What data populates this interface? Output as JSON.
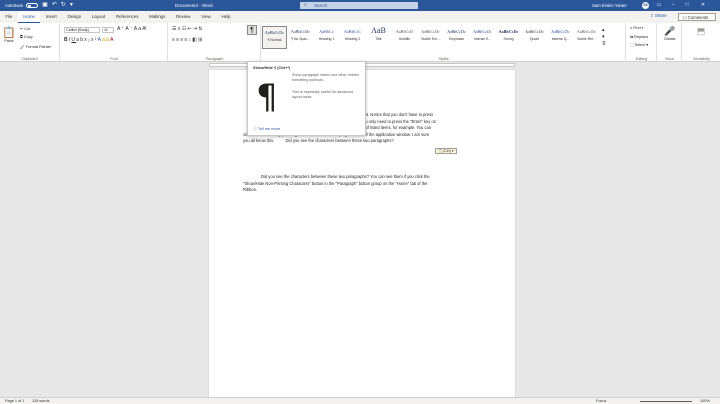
{
  "titlebar": {
    "autosave_label": "AutoSave",
    "autosave_state": "Off",
    "doc_title": "Document4 - Word",
    "search_placeholder": "Search",
    "user_name": "Sam Ervinn Yanter",
    "user_initials": "SE"
  },
  "tabs": [
    "File",
    "Home",
    "Insert",
    "Design",
    "Layout",
    "References",
    "Mailings",
    "Review",
    "View",
    "Help"
  ],
  "share_label": "Share",
  "comments_label": "Comments",
  "ribbon": {
    "clipboard": {
      "paste": "Paste",
      "cut": "Cut",
      "copy": "Copy",
      "format_painter": "Format Painter",
      "label": "Clipboard"
    },
    "font": {
      "font_name": "Calibri (Body)",
      "font_size": "11",
      "label": "Font"
    },
    "paragraph": {
      "label": "Paragraph"
    },
    "styles": {
      "label": "Styles",
      "items": [
        {
          "sample": "AaBbCcDc",
          "name": "¶ Normal"
        },
        {
          "sample": "AaBbCcDc",
          "name": "¶ No Spac..."
        },
        {
          "sample": "AaBbCc",
          "name": "Heading 1"
        },
        {
          "sample": "AaBbCcC",
          "name": "Heading 2"
        },
        {
          "sample": "AaB",
          "name": "Title"
        },
        {
          "sample": "AaBbCcD",
          "name": "Subtitle"
        },
        {
          "sample": "AaBbCcDc",
          "name": "Subtle Em..."
        },
        {
          "sample": "AaBbCcDc",
          "name": "Emphasis"
        },
        {
          "sample": "AaBbCcDc",
          "name": "Intense E..."
        },
        {
          "sample": "AaBbCcDc",
          "name": "Strong"
        },
        {
          "sample": "AaBbCcDc",
          "name": "Quote"
        },
        {
          "sample": "AaBbCcDc",
          "name": "Intense Q..."
        },
        {
          "sample": "AaBbCcDc",
          "name": "Subtle Ref..."
        }
      ]
    },
    "editing": {
      "find": "Find",
      "replace": "Replace",
      "select": "Select",
      "label": "Editing"
    },
    "voice": {
      "dictate": "Dictate",
      "label": "Voice"
    },
    "sensitivity": {
      "label": "Sensitivity"
    }
  },
  "tooltip": {
    "title": "Show/Hide ¶ (Ctrl+*)",
    "icon": "¶",
    "desc1": "Show paragraph marks and other hidden formatting symbols.",
    "desc2": "This is especially useful for advanced layout tasks.",
    "tell_me_more": "Tell me more"
  },
  "document": {
    "para1": {
      "line1": "document. Notice that you don't have to press",
      "line2": "lines. You only need to press the \"Enter\" key on",
      "line3": "of a line of listed items, for example. You can",
      "line4": "close a document by pressing the \"X\" button in the top right corner of the application window. I am sure",
      "line5": "you all know this.          Did you see the characters between these two paragraphs?"
    },
    "paste_tag": "(Ctrl) ▾",
    "para2": {
      "line1": "Did you see the characters between these two paragraphs? You can see them if you click the",
      "line2": "\"Show/Hide Non-Printing Characters\" button in the \"Paragraph\" button group on the \"Home\" tab of the",
      "line3": "Ribbon."
    }
  },
  "statusbar": {
    "page": "Page 1 of 1",
    "words": "128 words",
    "focus": "Focus",
    "zoom": "100%"
  }
}
